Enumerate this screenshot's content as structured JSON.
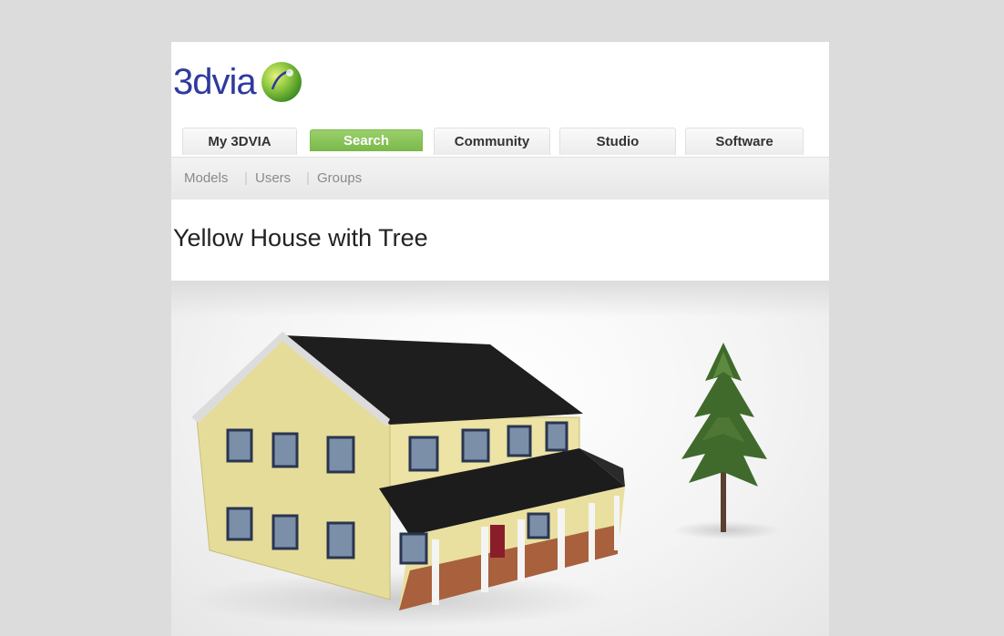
{
  "logo": {
    "text": "3dvia",
    "icon": "green-globe-logo-icon"
  },
  "tabs": [
    {
      "label": "My 3DVIA",
      "active": false
    },
    {
      "label": "Search",
      "active": true
    },
    {
      "label": "Community",
      "active": false
    },
    {
      "label": "Studio",
      "active": false
    },
    {
      "label": "Software",
      "active": false
    }
  ],
  "subnav": [
    {
      "label": "Models"
    },
    {
      "label": "Users"
    },
    {
      "label": "Groups"
    }
  ],
  "model": {
    "title": "Yellow House with Tree"
  },
  "colors": {
    "accent": "#7ab94a",
    "logo_blue": "#2f3a9e",
    "house_wall": "#e6dc9a",
    "roof": "#1c1c1c",
    "tree": "#3f6a2c"
  }
}
